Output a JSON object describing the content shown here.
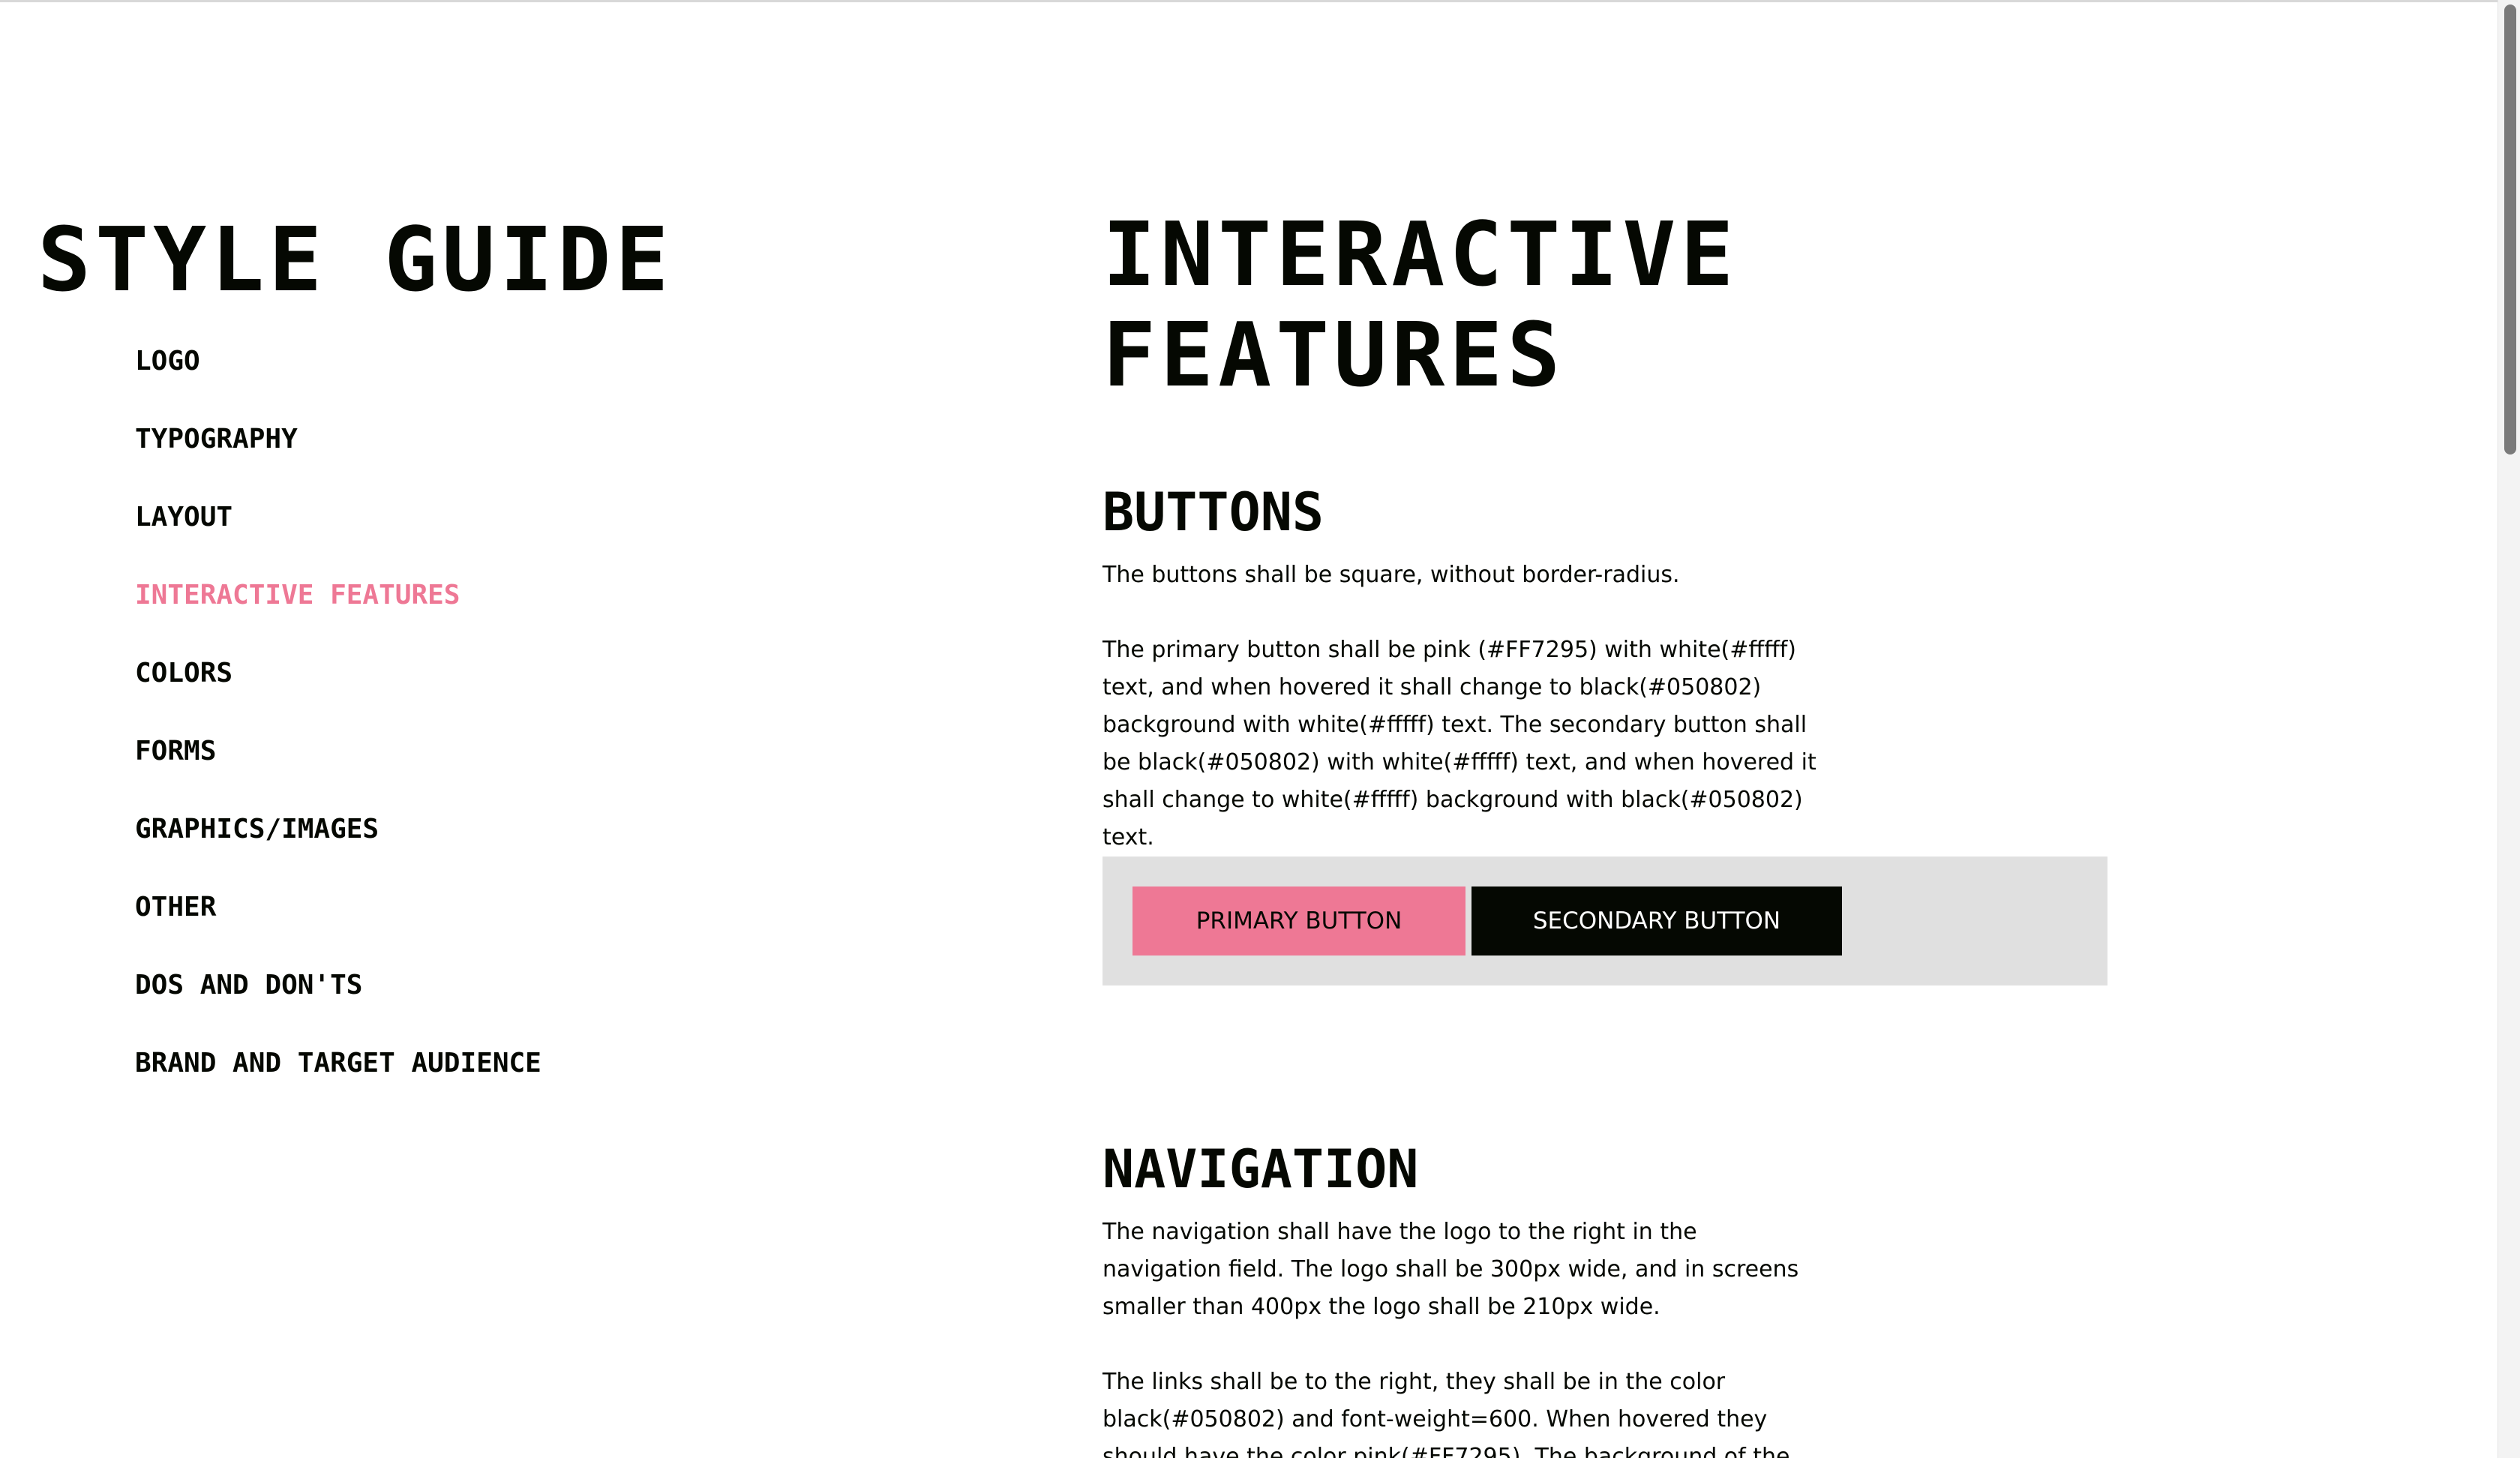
{
  "sidebar": {
    "title": "STYLE GUIDE",
    "items": [
      {
        "label": "LOGO",
        "active": false
      },
      {
        "label": "TYPOGRAPHY",
        "active": false
      },
      {
        "label": "LAYOUT",
        "active": false
      },
      {
        "label": "INTERACTIVE FEATURES",
        "active": true
      },
      {
        "label": "COLORS",
        "active": false
      },
      {
        "label": "FORMS",
        "active": false
      },
      {
        "label": "GRAPHICS/IMAGES",
        "active": false
      },
      {
        "label": "OTHER",
        "active": false
      },
      {
        "label": "DOS AND DON'TS",
        "active": false
      },
      {
        "label": "BRAND AND TARGET AUDIENCE",
        "active": false
      }
    ]
  },
  "main": {
    "title": "INTERACTIVE FEATURES",
    "buttons_section": {
      "heading": "BUTTONS",
      "para1": "The buttons shall be square, without border-radius.",
      "para2": "The primary button shall be pink (#FF7295) with white(#fffff) text, and when hovered it shall change to black(#050802) background with white(#fffff) text. The secondary button shall be black(#050802) with white(#fffff) text, and when hovered it shall change to white(#fffff) background with black(#050802) text.",
      "primary_label": "PRIMARY BUTTON",
      "secondary_label": "SECONDARY BUTTON"
    },
    "navigation_section": {
      "heading": "NAVIGATION",
      "para1": "The navigation shall have the logo to the right in the navigation field. The logo shall be 300px wide, and in screens smaller than 400px the logo shall be 210px wide.",
      "para2": "The links shall be to the right, they shall be in the color black(#050802) and font-weight=600. When hovered they should have the color pink(#FF7295). The background of the navigation"
    }
  },
  "colors": {
    "accent_pink": "#ee7895",
    "black": "#050802",
    "demo_background": "#e0e0e0"
  }
}
